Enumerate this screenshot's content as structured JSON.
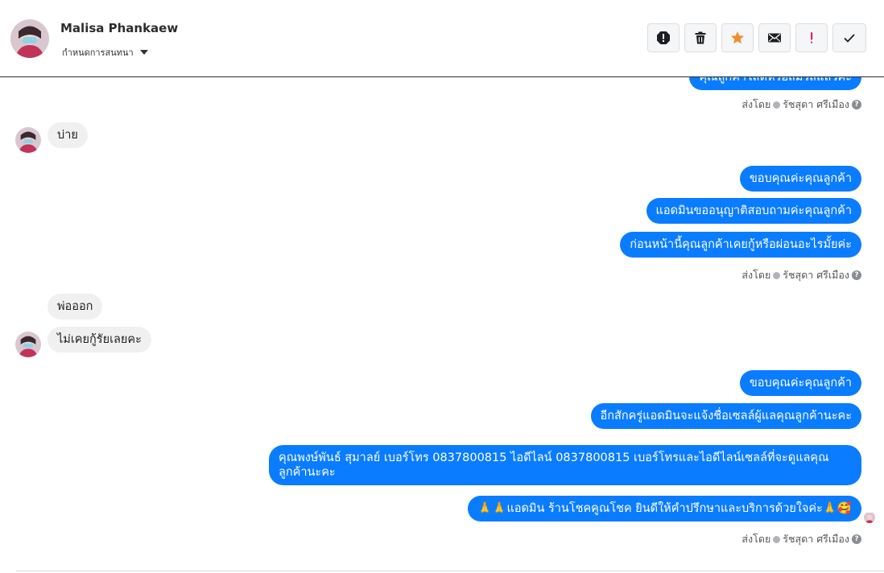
{
  "header": {
    "contact_name": "Malisa Phankaew",
    "assign_label": "กำหนดการสนทนา",
    "actions": [
      {
        "name": "report-spam-icon",
        "color": "#1c1e21"
      },
      {
        "name": "trash-icon",
        "color": "#1c1e21"
      },
      {
        "name": "star-icon",
        "color": "#f08e2d"
      },
      {
        "name": "envelope-icon",
        "color": "#1c1e21"
      },
      {
        "name": "exclamation-icon",
        "color": "#e0245e"
      },
      {
        "name": "check-icon",
        "color": "#1c1e21"
      }
    ]
  },
  "messages": [
    {
      "id": "m0",
      "dir": "out",
      "text": "คุณลูกค้าโสดหรือสมรสแล้วคะ"
    },
    {
      "id": "m1",
      "dir": "in",
      "text": "บ่าย"
    },
    {
      "id": "m2",
      "dir": "out",
      "text": "ขอบคุณค่ะคุณลูกค้า"
    },
    {
      "id": "m3",
      "dir": "out",
      "text": "แอดมินขออนุญาติสอบถามค่ะคุณลูกค้า"
    },
    {
      "id": "m4",
      "dir": "out",
      "text": "ก่อนหน้านี้คุณลูกค้าเคยกู้หรือผ่อนอะไรมั้ยค่ะ"
    },
    {
      "id": "m5",
      "dir": "in",
      "text": "พ่อออก"
    },
    {
      "id": "m6",
      "dir": "in",
      "text": "ไม่เคยกู้รัยเลยคะ"
    },
    {
      "id": "m7",
      "dir": "out",
      "text": "ขอบคุณค่ะคุณลูกค้า"
    },
    {
      "id": "m8",
      "dir": "out",
      "text": "อีกสักครู่แอดมินจะแจ้งชื่อเซลล์ผู้แลคุณลูกค้านะคะ"
    },
    {
      "id": "m9",
      "dir": "out",
      "text": "คุณพงษ์พันธ์ สุมาลย์      เบอร์โทร 0837800815  ไอดีไลน์ 0837800815     เบอร์โทรและไอดีไลน์เซลล์ที่จะดูแลคุณลูกค้านะคะ"
    },
    {
      "id": "m10",
      "dir": "out",
      "text": "🙏🙏แอดมิน ร้านโชคคูณโชค ยินดีให้คำปรึกษาและบริการด้วยใจค่ะ🙏🥰"
    }
  ],
  "sent_by": {
    "prefix": "ส่งโดย",
    "agent": "รัชสุดา ศรีเมือง",
    "help": "?"
  }
}
